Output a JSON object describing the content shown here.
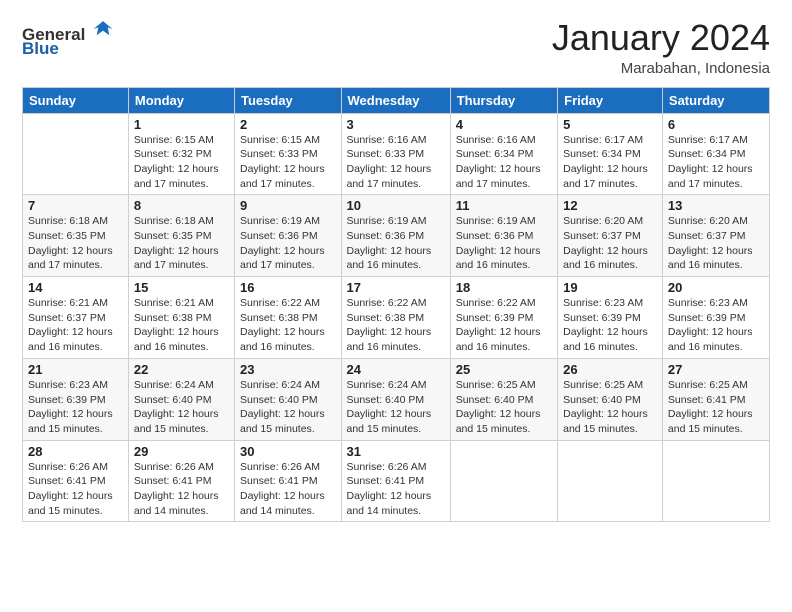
{
  "header": {
    "logo_general": "General",
    "logo_blue": "Blue",
    "month_title": "January 2024",
    "location": "Marabahan, Indonesia"
  },
  "days_of_week": [
    "Sunday",
    "Monday",
    "Tuesday",
    "Wednesday",
    "Thursday",
    "Friday",
    "Saturday"
  ],
  "weeks": [
    [
      {
        "day": "",
        "sunrise": "",
        "sunset": "",
        "daylight": ""
      },
      {
        "day": "1",
        "sunrise": "Sunrise: 6:15 AM",
        "sunset": "Sunset: 6:32 PM",
        "daylight": "Daylight: 12 hours and 17 minutes."
      },
      {
        "day": "2",
        "sunrise": "Sunrise: 6:15 AM",
        "sunset": "Sunset: 6:33 PM",
        "daylight": "Daylight: 12 hours and 17 minutes."
      },
      {
        "day": "3",
        "sunrise": "Sunrise: 6:16 AM",
        "sunset": "Sunset: 6:33 PM",
        "daylight": "Daylight: 12 hours and 17 minutes."
      },
      {
        "day": "4",
        "sunrise": "Sunrise: 6:16 AM",
        "sunset": "Sunset: 6:34 PM",
        "daylight": "Daylight: 12 hours and 17 minutes."
      },
      {
        "day": "5",
        "sunrise": "Sunrise: 6:17 AM",
        "sunset": "Sunset: 6:34 PM",
        "daylight": "Daylight: 12 hours and 17 minutes."
      },
      {
        "day": "6",
        "sunrise": "Sunrise: 6:17 AM",
        "sunset": "Sunset: 6:34 PM",
        "daylight": "Daylight: 12 hours and 17 minutes."
      }
    ],
    [
      {
        "day": "7",
        "sunrise": "Sunrise: 6:18 AM",
        "sunset": "Sunset: 6:35 PM",
        "daylight": "Daylight: 12 hours and 17 minutes."
      },
      {
        "day": "8",
        "sunrise": "Sunrise: 6:18 AM",
        "sunset": "Sunset: 6:35 PM",
        "daylight": "Daylight: 12 hours and 17 minutes."
      },
      {
        "day": "9",
        "sunrise": "Sunrise: 6:19 AM",
        "sunset": "Sunset: 6:36 PM",
        "daylight": "Daylight: 12 hours and 17 minutes."
      },
      {
        "day": "10",
        "sunrise": "Sunrise: 6:19 AM",
        "sunset": "Sunset: 6:36 PM",
        "daylight": "Daylight: 12 hours and 16 minutes."
      },
      {
        "day": "11",
        "sunrise": "Sunrise: 6:19 AM",
        "sunset": "Sunset: 6:36 PM",
        "daylight": "Daylight: 12 hours and 16 minutes."
      },
      {
        "day": "12",
        "sunrise": "Sunrise: 6:20 AM",
        "sunset": "Sunset: 6:37 PM",
        "daylight": "Daylight: 12 hours and 16 minutes."
      },
      {
        "day": "13",
        "sunrise": "Sunrise: 6:20 AM",
        "sunset": "Sunset: 6:37 PM",
        "daylight": "Daylight: 12 hours and 16 minutes."
      }
    ],
    [
      {
        "day": "14",
        "sunrise": "Sunrise: 6:21 AM",
        "sunset": "Sunset: 6:37 PM",
        "daylight": "Daylight: 12 hours and 16 minutes."
      },
      {
        "day": "15",
        "sunrise": "Sunrise: 6:21 AM",
        "sunset": "Sunset: 6:38 PM",
        "daylight": "Daylight: 12 hours and 16 minutes."
      },
      {
        "day": "16",
        "sunrise": "Sunrise: 6:22 AM",
        "sunset": "Sunset: 6:38 PM",
        "daylight": "Daylight: 12 hours and 16 minutes."
      },
      {
        "day": "17",
        "sunrise": "Sunrise: 6:22 AM",
        "sunset": "Sunset: 6:38 PM",
        "daylight": "Daylight: 12 hours and 16 minutes."
      },
      {
        "day": "18",
        "sunrise": "Sunrise: 6:22 AM",
        "sunset": "Sunset: 6:39 PM",
        "daylight": "Daylight: 12 hours and 16 minutes."
      },
      {
        "day": "19",
        "sunrise": "Sunrise: 6:23 AM",
        "sunset": "Sunset: 6:39 PM",
        "daylight": "Daylight: 12 hours and 16 minutes."
      },
      {
        "day": "20",
        "sunrise": "Sunrise: 6:23 AM",
        "sunset": "Sunset: 6:39 PM",
        "daylight": "Daylight: 12 hours and 16 minutes."
      }
    ],
    [
      {
        "day": "21",
        "sunrise": "Sunrise: 6:23 AM",
        "sunset": "Sunset: 6:39 PM",
        "daylight": "Daylight: 12 hours and 15 minutes."
      },
      {
        "day": "22",
        "sunrise": "Sunrise: 6:24 AM",
        "sunset": "Sunset: 6:40 PM",
        "daylight": "Daylight: 12 hours and 15 minutes."
      },
      {
        "day": "23",
        "sunrise": "Sunrise: 6:24 AM",
        "sunset": "Sunset: 6:40 PM",
        "daylight": "Daylight: 12 hours and 15 minutes."
      },
      {
        "day": "24",
        "sunrise": "Sunrise: 6:24 AM",
        "sunset": "Sunset: 6:40 PM",
        "daylight": "Daylight: 12 hours and 15 minutes."
      },
      {
        "day": "25",
        "sunrise": "Sunrise: 6:25 AM",
        "sunset": "Sunset: 6:40 PM",
        "daylight": "Daylight: 12 hours and 15 minutes."
      },
      {
        "day": "26",
        "sunrise": "Sunrise: 6:25 AM",
        "sunset": "Sunset: 6:40 PM",
        "daylight": "Daylight: 12 hours and 15 minutes."
      },
      {
        "day": "27",
        "sunrise": "Sunrise: 6:25 AM",
        "sunset": "Sunset: 6:41 PM",
        "daylight": "Daylight: 12 hours and 15 minutes."
      }
    ],
    [
      {
        "day": "28",
        "sunrise": "Sunrise: 6:26 AM",
        "sunset": "Sunset: 6:41 PM",
        "daylight": "Daylight: 12 hours and 15 minutes."
      },
      {
        "day": "29",
        "sunrise": "Sunrise: 6:26 AM",
        "sunset": "Sunset: 6:41 PM",
        "daylight": "Daylight: 12 hours and 14 minutes."
      },
      {
        "day": "30",
        "sunrise": "Sunrise: 6:26 AM",
        "sunset": "Sunset: 6:41 PM",
        "daylight": "Daylight: 12 hours and 14 minutes."
      },
      {
        "day": "31",
        "sunrise": "Sunrise: 6:26 AM",
        "sunset": "Sunset: 6:41 PM",
        "daylight": "Daylight: 12 hours and 14 minutes."
      },
      {
        "day": "",
        "sunrise": "",
        "sunset": "",
        "daylight": ""
      },
      {
        "day": "",
        "sunrise": "",
        "sunset": "",
        "daylight": ""
      },
      {
        "day": "",
        "sunrise": "",
        "sunset": "",
        "daylight": ""
      }
    ]
  ]
}
